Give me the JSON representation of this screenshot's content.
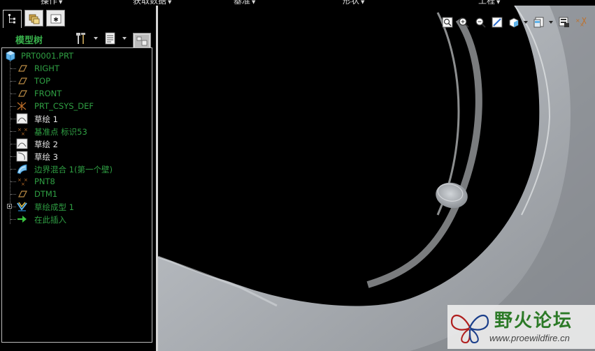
{
  "menubar": {
    "items": [
      "操作",
      "获取数据",
      "基准",
      "形状",
      "工程"
    ]
  },
  "tree_panel": {
    "title": "模型树",
    "items": [
      {
        "label": "PRT0001.PRT",
        "icon": "part-icon",
        "color": "green"
      },
      {
        "label": "RIGHT",
        "icon": "datum-plane-icon",
        "color": "green"
      },
      {
        "label": "TOP",
        "icon": "datum-plane-icon",
        "color": "green"
      },
      {
        "label": "FRONT",
        "icon": "datum-plane-icon",
        "color": "green"
      },
      {
        "label": "PRT_CSYS_DEF",
        "icon": "csys-icon",
        "color": "green"
      },
      {
        "label": "草绘 1",
        "icon": "sketch-icon",
        "color": "white"
      },
      {
        "label": "基准点 标识53",
        "icon": "datum-point-icon",
        "color": "green"
      },
      {
        "label": "草绘 2",
        "icon": "sketch-icon",
        "color": "white"
      },
      {
        "label": "草绘 3",
        "icon": "sketch-icon",
        "color": "white"
      },
      {
        "label": "边界混合 1(第一个壁)",
        "icon": "boundary-blend-icon",
        "color": "green"
      },
      {
        "label": "PNT8",
        "icon": "datum-point-icon",
        "color": "green"
      },
      {
        "label": "DTM1",
        "icon": "datum-plane-icon",
        "color": "green"
      },
      {
        "label": "草绘成型 1",
        "icon": "sketched-form-icon",
        "color": "green"
      },
      {
        "label": "在此插入",
        "icon": "insert-here-arrow-icon",
        "color": "green"
      }
    ]
  },
  "watermark": {
    "title": "野火论坛",
    "url": "www.proewildfire.cn"
  },
  "colors": {
    "tree_green": "#2f9f43",
    "tree_white": "#e8e8e8",
    "model_gray": "#a7abb0",
    "background": "#000000"
  }
}
